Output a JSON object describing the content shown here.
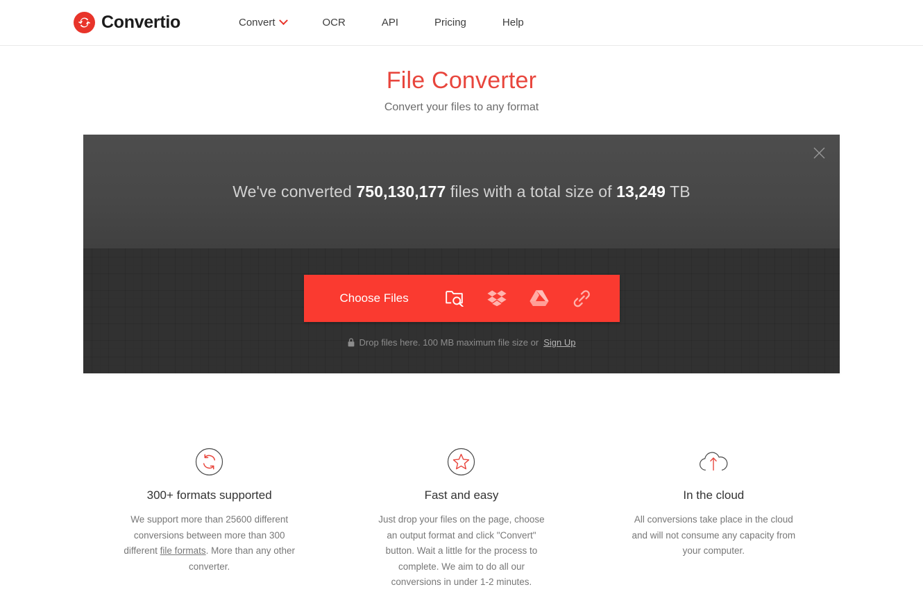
{
  "header": {
    "brand_name": "Convertio",
    "brand_icon": "convertio-logo-icon",
    "nav": [
      {
        "label": "Convert",
        "has_dropdown": true,
        "icon": "chevron-down-icon"
      },
      {
        "label": "OCR",
        "has_dropdown": false
      },
      {
        "label": "API",
        "has_dropdown": false
      },
      {
        "label": "Pricing",
        "has_dropdown": false
      },
      {
        "label": "Help",
        "has_dropdown": false
      }
    ]
  },
  "hero": {
    "title": "File Converter",
    "subtitle": "Convert your files to any format",
    "title_color": "#e8453c"
  },
  "stats": {
    "prefix": "We've converted ",
    "files_count": "750,130,177",
    "middle": " files with a total size of ",
    "total_size": "13,249",
    "suffix": " TB",
    "close_icon": "close-icon"
  },
  "uploader": {
    "choose_files_label": "Choose Files",
    "sources": [
      {
        "name": "from-computer",
        "icon": "folder-search-icon",
        "title": "From Computer"
      },
      {
        "name": "from-dropbox",
        "icon": "dropbox-icon",
        "title": "From Dropbox"
      },
      {
        "name": "from-google-drive",
        "icon": "google-drive-icon",
        "title": "From Google Drive"
      },
      {
        "name": "from-url",
        "icon": "link-icon",
        "title": "From URL"
      }
    ],
    "hint_icon": "lock-icon",
    "hint_text": "Drop files here. 100 MB maximum file size or ",
    "hint_link": "Sign Up",
    "accent_color": "#fa3a30"
  },
  "features": [
    {
      "icon": "refresh-circle-icon",
      "title": "300+ formats supported",
      "desc_before": "We support more than 25600 different conversions between more than 300 different ",
      "desc_link": "file formats",
      "desc_after": ". More than any other converter."
    },
    {
      "icon": "star-circle-icon",
      "title": "Fast and easy",
      "desc_before": "Just drop your files on the page, choose an output format and click \"Convert\" button. Wait a little for the process to complete. We aim to do all our conversions in under 1-2 minutes.",
      "desc_link": "",
      "desc_after": ""
    },
    {
      "icon": "cloud-upload-icon",
      "title": "In the cloud",
      "desc_before": "All conversions take place in the cloud and will not consume any capacity from your computer.",
      "desc_link": "",
      "desc_after": ""
    }
  ]
}
